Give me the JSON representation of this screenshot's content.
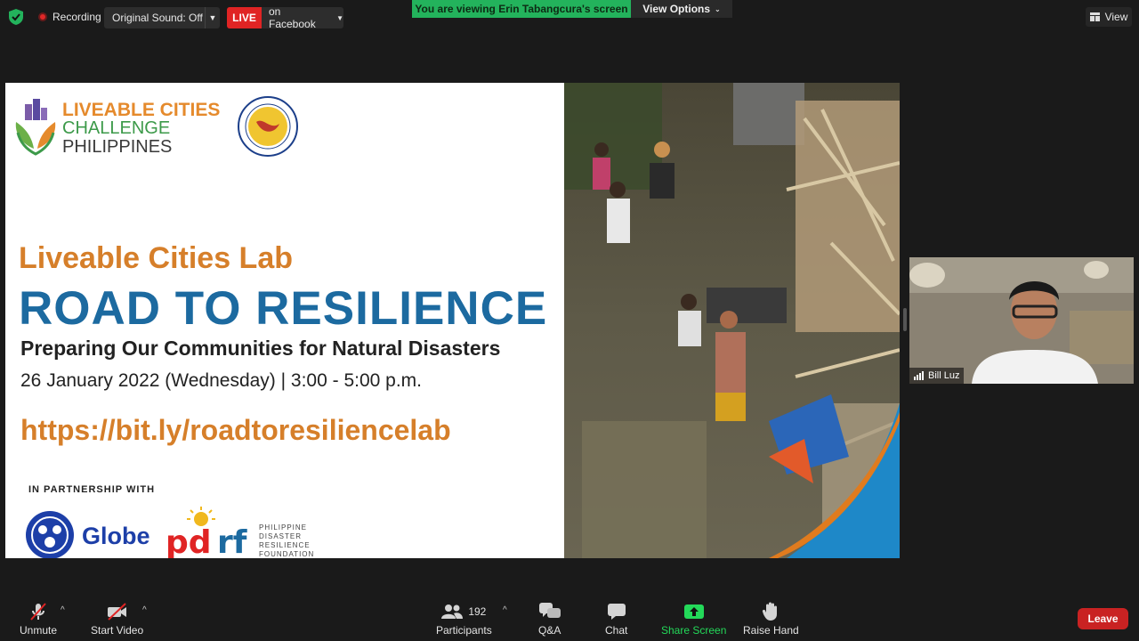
{
  "topbar": {
    "recording_label": "Recording",
    "original_sound": "Original Sound: Off",
    "live_badge": "LIVE",
    "live_target": "on Facebook",
    "viewing_banner": "You are viewing Erin Tabangcura's screen",
    "view_options": "View Options",
    "view_label": "View"
  },
  "slide": {
    "org_line1": "LIVEABLE CITIES",
    "org_line2": "CHALLENGE",
    "org_line3": "PHILIPPINES",
    "lab_title": "Liveable Cities Lab",
    "main_title": "ROAD TO RESILIENCE",
    "subtitle": "Preparing Our Communities for Natural Disasters",
    "date_time": "26 January 2022 (Wednesday) | 3:00 - 5:00 p.m.",
    "url": "https://bit.ly/roadtoresiliencelab",
    "partnership": "IN PARTNERSHIP WITH",
    "partner1": "Globe",
    "partner2_lines": [
      "PHILIPPINE",
      "DISASTER",
      "RESILIENCE",
      "FOUNDATION"
    ]
  },
  "participant": {
    "name": "Bill Luz"
  },
  "toolbar": {
    "unmute": "Unmute",
    "start_video": "Start Video",
    "participants": "Participants",
    "participant_count": "192",
    "qa": "Q&A",
    "chat": "Chat",
    "share_screen": "Share Screen",
    "raise_hand": "Raise Hand",
    "leave": "Leave"
  },
  "colors": {
    "live_red": "#e02424",
    "banner_green": "#23b35c",
    "share_green": "#23d959",
    "leave_red": "#c92222"
  }
}
